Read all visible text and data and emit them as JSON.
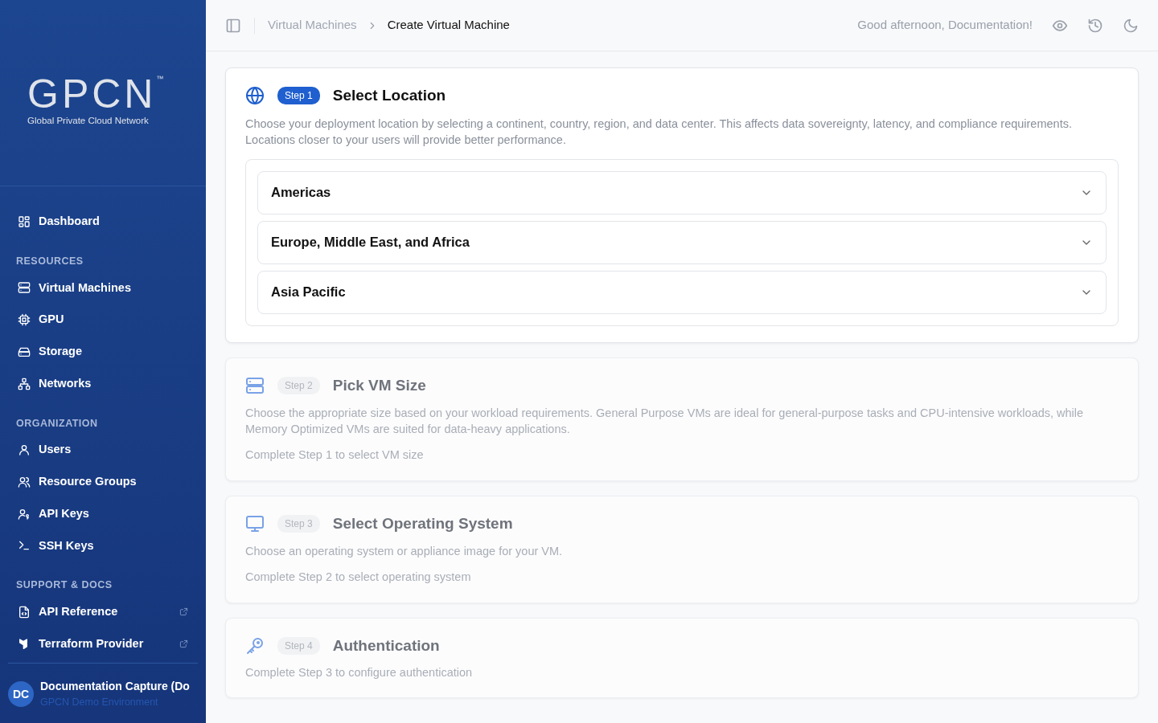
{
  "sidebar": {
    "logo": {
      "mark": "GPCN",
      "tm": "™",
      "tagline": "Global Private Cloud Network"
    },
    "items": [
      {
        "label": "Dashboard",
        "selected": false,
        "external": false
      }
    ],
    "sections": [
      {
        "title": "RESOURCES",
        "items": [
          {
            "label": "Virtual Machines",
            "selected": false,
            "external": false
          },
          {
            "label": "GPU",
            "selected": false,
            "external": false
          },
          {
            "label": "Storage",
            "selected": false,
            "external": false
          },
          {
            "label": "Networks",
            "selected": false,
            "external": false
          }
        ]
      },
      {
        "title": "ORGANIZATION",
        "items": [
          {
            "label": "Users",
            "selected": false,
            "external": false
          },
          {
            "label": "Resource Groups",
            "selected": false,
            "external": false
          },
          {
            "label": "API Keys",
            "selected": false,
            "external": false
          },
          {
            "label": "SSH Keys",
            "selected": false,
            "external": false
          }
        ]
      },
      {
        "title": "SUPPORT & DOCS",
        "items": [
          {
            "label": "API Reference",
            "selected": false,
            "external": true
          },
          {
            "label": "Terraform Provider",
            "selected": false,
            "external": true
          }
        ]
      }
    ],
    "user": {
      "initials": "DC",
      "name": "Documentation Capture (Do",
      "org": "GPCN Demo Environment"
    }
  },
  "topbar": {
    "breadcrumbs": [
      {
        "label": "Virtual Machines",
        "current": false
      },
      {
        "label": "Create Virtual Machine",
        "current": true
      }
    ],
    "greeting": "Good afternoon, Documentation!"
  },
  "steps": [
    {
      "badge": "Step 1",
      "title": "Select Location",
      "active": true,
      "description": "Choose your deployment location by selecting a continent, country, region, and data center. This affects data sovereignty, latency, and compliance requirements. Locations closer to your users will provide better performance.",
      "regions": [
        {
          "label": "Americas",
          "expanded": false
        },
        {
          "label": "Europe, Middle East, and Africa",
          "expanded": false
        },
        {
          "label": "Asia Pacific",
          "expanded": false
        }
      ]
    },
    {
      "badge": "Step 2",
      "title": "Pick VM Size",
      "active": false,
      "description": "Choose the appropriate size based on your workload requirements. General Purpose VMs are ideal for general-purpose tasks and CPU-intensive workloads, while Memory Optimized VMs are suited for data-heavy applications.",
      "hint": "Complete Step 1 to select VM size"
    },
    {
      "badge": "Step 3",
      "title": "Select Operating System",
      "active": false,
      "description": "Choose an operating system or appliance image for your VM.",
      "hint": "Complete Step 2 to select operating system"
    },
    {
      "badge": "Step 4",
      "title": "Authentication",
      "active": false,
      "hint": "Complete Step 3 to configure authentication"
    }
  ]
}
